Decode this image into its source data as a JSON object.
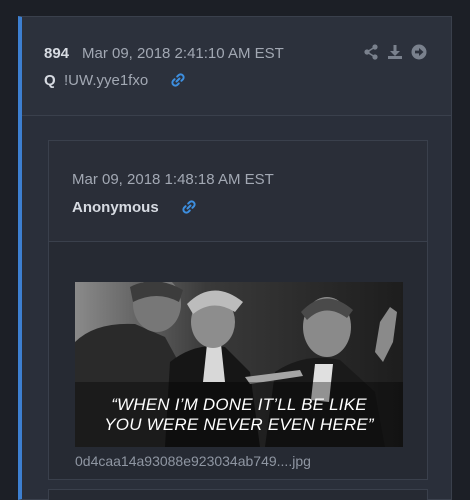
{
  "post": {
    "number": "894",
    "date": "Mar 09, 2018 2:41:10 AM EST",
    "author": "Q",
    "tripcode": "!UW.yye1fxo",
    "icons": {
      "link": "link-icon",
      "share": "share-icon",
      "download": "download-icon",
      "goto": "arrow-right-circle-icon"
    }
  },
  "quoted": {
    "date": "Mar 09, 2018 1:48:18 AM EST",
    "author": "Anonymous",
    "image_caption_line1": "“WHEN I’M DONE IT’LL BE LIKE",
    "image_caption_line2": "YOU WERE NEVER EVEN HERE”",
    "filename": "0d4caa14a93088e923034ab749....jpg"
  },
  "colors": {
    "background": "#1c1f26",
    "card": "#2a2f3a",
    "accent": "#3d7fd0",
    "text": "#d7dbe2",
    "muted": "#a2a8b3"
  }
}
